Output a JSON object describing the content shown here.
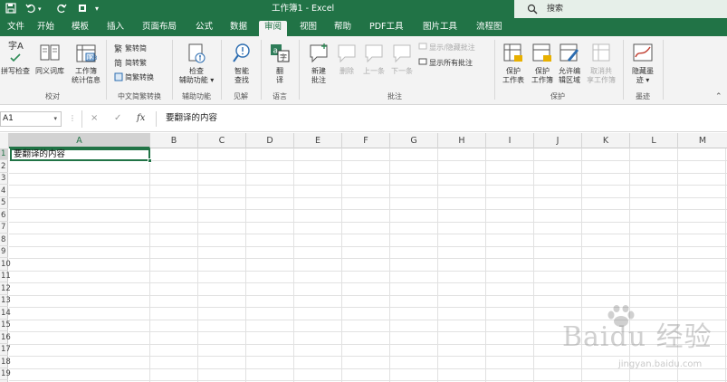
{
  "titlebar": {
    "title": "工作簿1  -  Excel",
    "search_placeholder": "搜索",
    "quick_access": [
      "save-icon",
      "undo-icon",
      "redo-icon",
      "customize-icon"
    ],
    "color": "#217346"
  },
  "tabs": [
    {
      "label": "文件"
    },
    {
      "label": "开始"
    },
    {
      "label": "模板"
    },
    {
      "label": "插入"
    },
    {
      "label": "页面布局"
    },
    {
      "label": "公式"
    },
    {
      "label": "数据"
    },
    {
      "label": "审阅"
    },
    {
      "label": "视图"
    },
    {
      "label": "帮助"
    },
    {
      "label": "PDF工具"
    },
    {
      "label": "图片工具"
    },
    {
      "label": "流程图"
    }
  ],
  "active_tab": "审阅",
  "ribbon": {
    "proofing": {
      "spell_icon_text": "字A",
      "spell": "拼写检查",
      "thesaurus": "同义词库",
      "stats_line1": "工作簿",
      "stats_line2": "统计信息",
      "group": "校对"
    },
    "chinese": {
      "t2s": "繁转简",
      "s2t": "简转繁",
      "convert": "简繁转换",
      "group": "中文简繁转换"
    },
    "accessibility": {
      "check_line1": "检查",
      "check_line2": "辅助功能",
      "group": "辅助功能"
    },
    "insights": {
      "smart_line1": "智能",
      "smart_line2": "查找",
      "group": "见解"
    },
    "language": {
      "translate_line1": "翻",
      "translate_line2": "译",
      "group": "语言"
    },
    "comments": {
      "new_line1": "新建",
      "new_line2": "批注",
      "delete": "删除",
      "prev": "上一条",
      "next": "下一条",
      "show_hide": "显示/隐藏批注",
      "show_all": "显示所有批注",
      "group": "批注"
    },
    "protect": {
      "sheet_line1": "保护",
      "sheet_line2": "工作表",
      "workbook_line1": "保护",
      "workbook_line2": "工作簿",
      "allow_line1": "允许编",
      "allow_line2": "辑区域",
      "unshare_line1": "取消共",
      "unshare_line2": "享工作簿",
      "group": "保护"
    },
    "ink": {
      "hide_line1": "隐藏墨",
      "hide_line2": "迹",
      "group": "墨迹"
    }
  },
  "formula_bar": {
    "name_box": "A1",
    "cancel": "×",
    "enter": "✓",
    "fx": "fx",
    "content": "要翻译的内容"
  },
  "grid": {
    "columns": [
      "A",
      "B",
      "C",
      "D",
      "E",
      "F",
      "G",
      "H",
      "I",
      "J",
      "K",
      "L",
      "M"
    ],
    "rows": [
      "1",
      "2",
      "3",
      "4",
      "5",
      "6",
      "7",
      "8",
      "9",
      "10",
      "11",
      "12",
      "13",
      "14",
      "15",
      "16",
      "17",
      "18",
      "19"
    ],
    "selected_cell": "A1",
    "a1_value": "要翻译的内容"
  },
  "watermark": {
    "brand": "Baidu 经验",
    "url": "jingyan.baidu.com"
  }
}
